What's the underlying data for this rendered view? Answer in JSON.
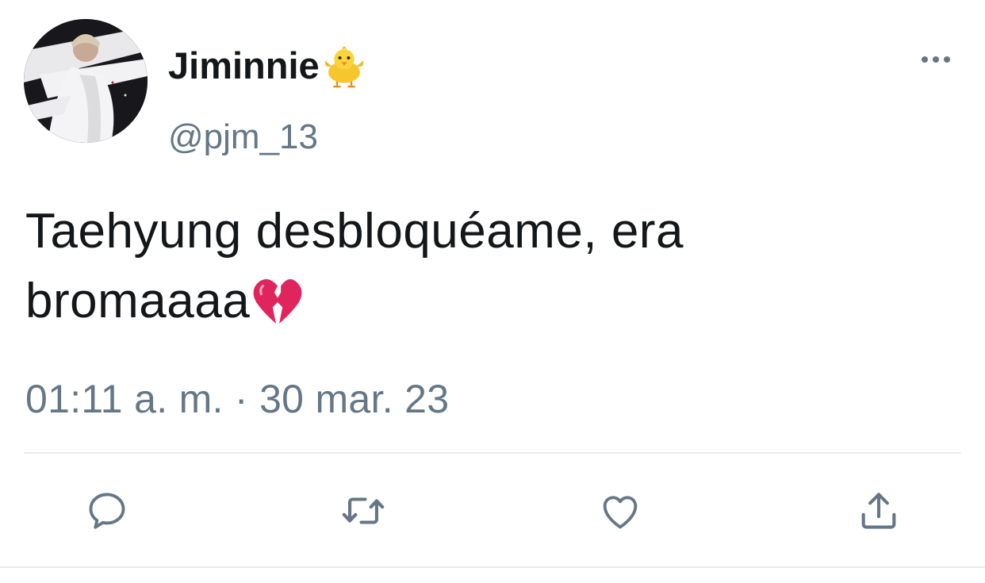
{
  "tweet": {
    "display_name": "Jiminnie",
    "name_emoji": "chick-icon",
    "handle": "@pjm_13",
    "text_line1": "Taehyung desbloquéame, era",
    "text_line2": "bromaaaa",
    "text_emoji": "broken-heart-icon",
    "timestamp": "01:11 a. m. · 30 mar. 23"
  },
  "actions": [
    {
      "name": "reply",
      "icon": "reply-icon"
    },
    {
      "name": "retweet",
      "icon": "retweet-icon"
    },
    {
      "name": "like",
      "icon": "heart-icon"
    },
    {
      "name": "share",
      "icon": "share-icon"
    }
  ],
  "colors": {
    "text": "#14171a",
    "secondary": "#657786",
    "divider": "#e6ecf0",
    "heart": "#e0245e"
  }
}
